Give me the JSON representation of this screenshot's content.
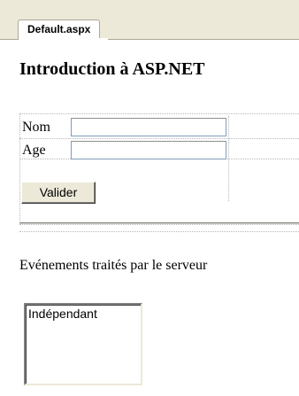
{
  "tab": {
    "label": "Default.aspx"
  },
  "page": {
    "title": "Introduction à ASP.NET"
  },
  "form": {
    "nom_label": "Nom",
    "nom_value": "",
    "age_label": "Age",
    "age_value": "",
    "submit_label": "Valider"
  },
  "events": {
    "label": "Evénements traités par le serveur",
    "items": [
      "Indépendant"
    ]
  }
}
